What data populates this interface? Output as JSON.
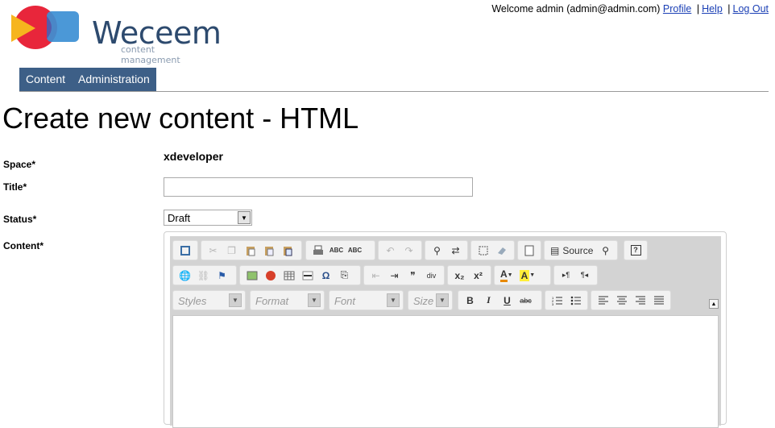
{
  "brand": {
    "name": "Weceem",
    "tagline": "content management"
  },
  "user_bar": {
    "welcome": "Welcome admin (admin@admin.com)",
    "profile": "Profile",
    "help": "Help",
    "logout": "Log Out",
    "separator": "|"
  },
  "nav": {
    "tabs": [
      "Content",
      "Administration"
    ]
  },
  "page": {
    "title": "Create new content - HTML"
  },
  "form": {
    "space_label": "Space*",
    "space_value": "xdeveloper",
    "title_label": "Title*",
    "title_value": "",
    "status_label": "Status*",
    "status_value": "Draft",
    "content_label": "Content*"
  },
  "editor": {
    "source_label": "Source",
    "combos": {
      "styles": "Styles",
      "format": "Format",
      "font": "Font",
      "size": "Size"
    },
    "glyphs": {
      "abc": "ABC",
      "bold": "B",
      "italic": "I",
      "underline": "U",
      "strike": "abc",
      "sub": "x₂",
      "sup": "x²",
      "quote": "❞",
      "omega": "Ω",
      "help": "?",
      "font_color": "A",
      "bg_color": "A",
      "ltr": "▸¶",
      "rtl": "¶◂",
      "div": "div"
    }
  },
  "colors": {
    "nav_bg": "#3d5f87",
    "link": "#1a3fb5",
    "brand_text": "#2d4a6e"
  }
}
